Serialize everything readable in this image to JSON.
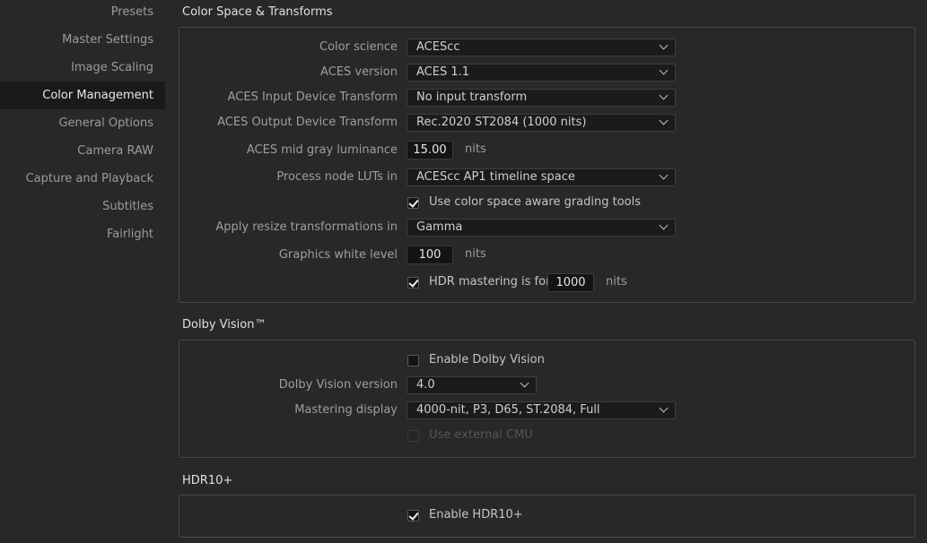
{
  "sidebar": {
    "items": [
      {
        "label": "Presets"
      },
      {
        "label": "Master Settings"
      },
      {
        "label": "Image Scaling"
      },
      {
        "label": "Color Management",
        "active": true
      },
      {
        "label": "General Options"
      },
      {
        "label": "Camera RAW"
      },
      {
        "label": "Capture and Playback"
      },
      {
        "label": "Subtitles"
      },
      {
        "label": "Fairlight"
      }
    ]
  },
  "color_space": {
    "title": "Color Space & Transforms",
    "color_science": {
      "label": "Color science",
      "value": "ACEScc"
    },
    "aces_version": {
      "label": "ACES version",
      "value": "ACES 1.1"
    },
    "aces_idt": {
      "label": "ACES Input Device Transform",
      "value": "No input transform"
    },
    "aces_odt": {
      "label": "ACES Output Device Transform",
      "value": "Rec.2020 ST2084 (1000 nits)"
    },
    "mid_gray": {
      "label": "ACES mid gray luminance",
      "value": "15.00",
      "unit": "nits"
    },
    "process_node_luts": {
      "label": "Process node LUTs in",
      "value": "ACEScc AP1 timeline space"
    },
    "grading_tools": {
      "label": "Use color space aware grading tools",
      "checked": true
    },
    "resize": {
      "label": "Apply resize transformations in",
      "value": "Gamma"
    },
    "graphics_white": {
      "label": "Graphics white level",
      "value": "100",
      "unit": "nits"
    },
    "hdr_mastering": {
      "label": "HDR mastering is for",
      "checked": true,
      "value": "1000",
      "unit": "nits"
    }
  },
  "dolby": {
    "title": "Dolby Vision™",
    "enable": {
      "label": "Enable Dolby Vision",
      "checked": false
    },
    "version": {
      "label": "Dolby Vision version",
      "value": "4.0"
    },
    "mastering_display": {
      "label": "Mastering display",
      "value": "4000-nit, P3, D65, ST.2084, Full"
    },
    "external_cmu": {
      "label": "Use external CMU",
      "checked": false,
      "disabled": true
    }
  },
  "hdr10": {
    "title": "HDR10+",
    "enable": {
      "label": "Enable HDR10+",
      "checked": true
    }
  }
}
